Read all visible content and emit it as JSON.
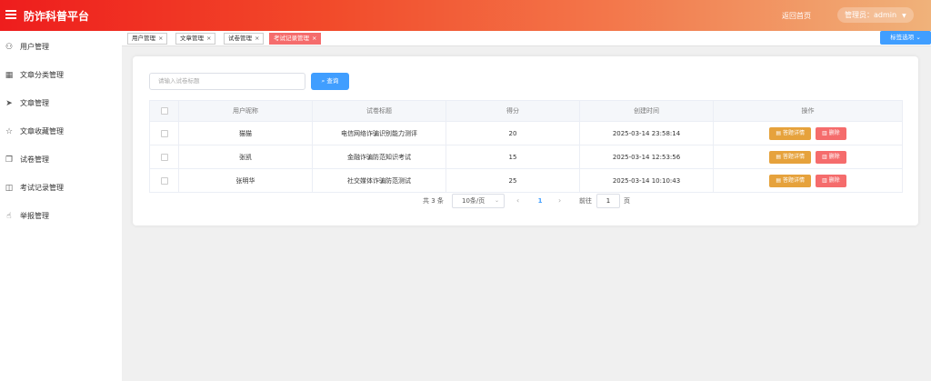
{
  "header": {
    "brand": "防诈科普平台",
    "back_home": "返回首页",
    "admin_label": "管理员：admin"
  },
  "sidebar": {
    "items": [
      {
        "label": "用户管理",
        "icon": "user-icon"
      },
      {
        "label": "文章分类管理",
        "icon": "grid-icon"
      },
      {
        "label": "文章管理",
        "icon": "send-icon"
      },
      {
        "label": "文章收藏管理",
        "icon": "star-icon"
      },
      {
        "label": "试卷管理",
        "icon": "copy-icon"
      },
      {
        "label": "考试记录管理",
        "icon": "book-icon"
      },
      {
        "label": "举报管理",
        "icon": "hand-icon"
      }
    ]
  },
  "tabs": [
    {
      "label": "用户管理",
      "active": false
    },
    {
      "label": "文章管理",
      "active": false
    },
    {
      "label": "试卷管理",
      "active": false
    },
    {
      "label": "考试记录管理",
      "active": true
    }
  ],
  "tab_options": "标签选项",
  "search": {
    "placeholder": "请输入试卷标题",
    "button": "查询"
  },
  "table": {
    "columns": [
      "用户昵称",
      "试卷标题",
      "得分",
      "创建时间",
      "操作"
    ],
    "rows": [
      {
        "nickname": "猫猫",
        "title": "电信网络诈骗识别能力测评",
        "score": "20",
        "created": "2025-03-14 23:58:14"
      },
      {
        "nickname": "张凯",
        "title": "金融诈骗防范知识考试",
        "score": "15",
        "created": "2025-03-14 12:53:56"
      },
      {
        "nickname": "张明华",
        "title": "社交媒体诈骗防范测试",
        "score": "25",
        "created": "2025-03-14 10:10:43"
      }
    ],
    "detail_btn": "答题详情",
    "delete_btn": "删除"
  },
  "pagination": {
    "total": "共 3 条",
    "page_size": "10条/页",
    "current": "1",
    "goto_prefix": "前往",
    "goto_value": "1",
    "goto_suffix": "页"
  },
  "colors": {
    "primary": "#409eff",
    "danger": "#f56c6c",
    "warning": "#e6a23c"
  }
}
